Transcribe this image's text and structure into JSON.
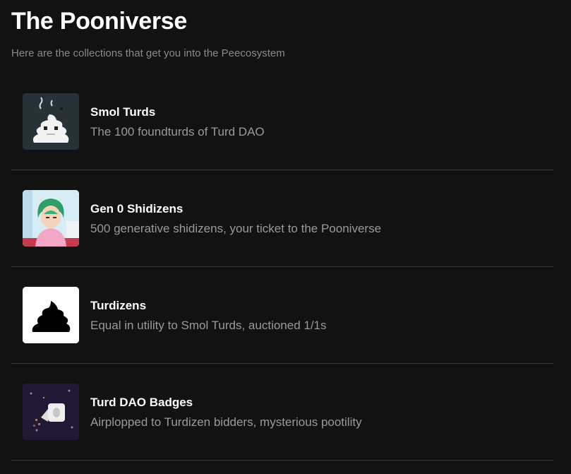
{
  "header": {
    "title": "The Pooniverse",
    "subtitle": "Here are the collections that get you into the Peecosystem"
  },
  "collections": [
    {
      "name": "Smol Turds",
      "description": "The 100 foundturds of Turd DAO",
      "icon": "smol-turd-icon"
    },
    {
      "name": "Gen 0 Shidizens",
      "description": "500 generative shidizens, your ticket to the Pooniverse",
      "icon": "shidizen-icon"
    },
    {
      "name": "Turdizens",
      "description": "Equal in utility to Smol Turds, auctioned 1/1s",
      "icon": "turdizen-icon"
    },
    {
      "name": "Turd DAO Badges",
      "description": "Airplopped to Turdizen bidders, mysterious pootility",
      "icon": "badge-icon"
    }
  ],
  "colors": {
    "background": "#121212",
    "title": "#ffffff",
    "muted": "#9a9a9a",
    "divider": "#3a3a3a"
  }
}
